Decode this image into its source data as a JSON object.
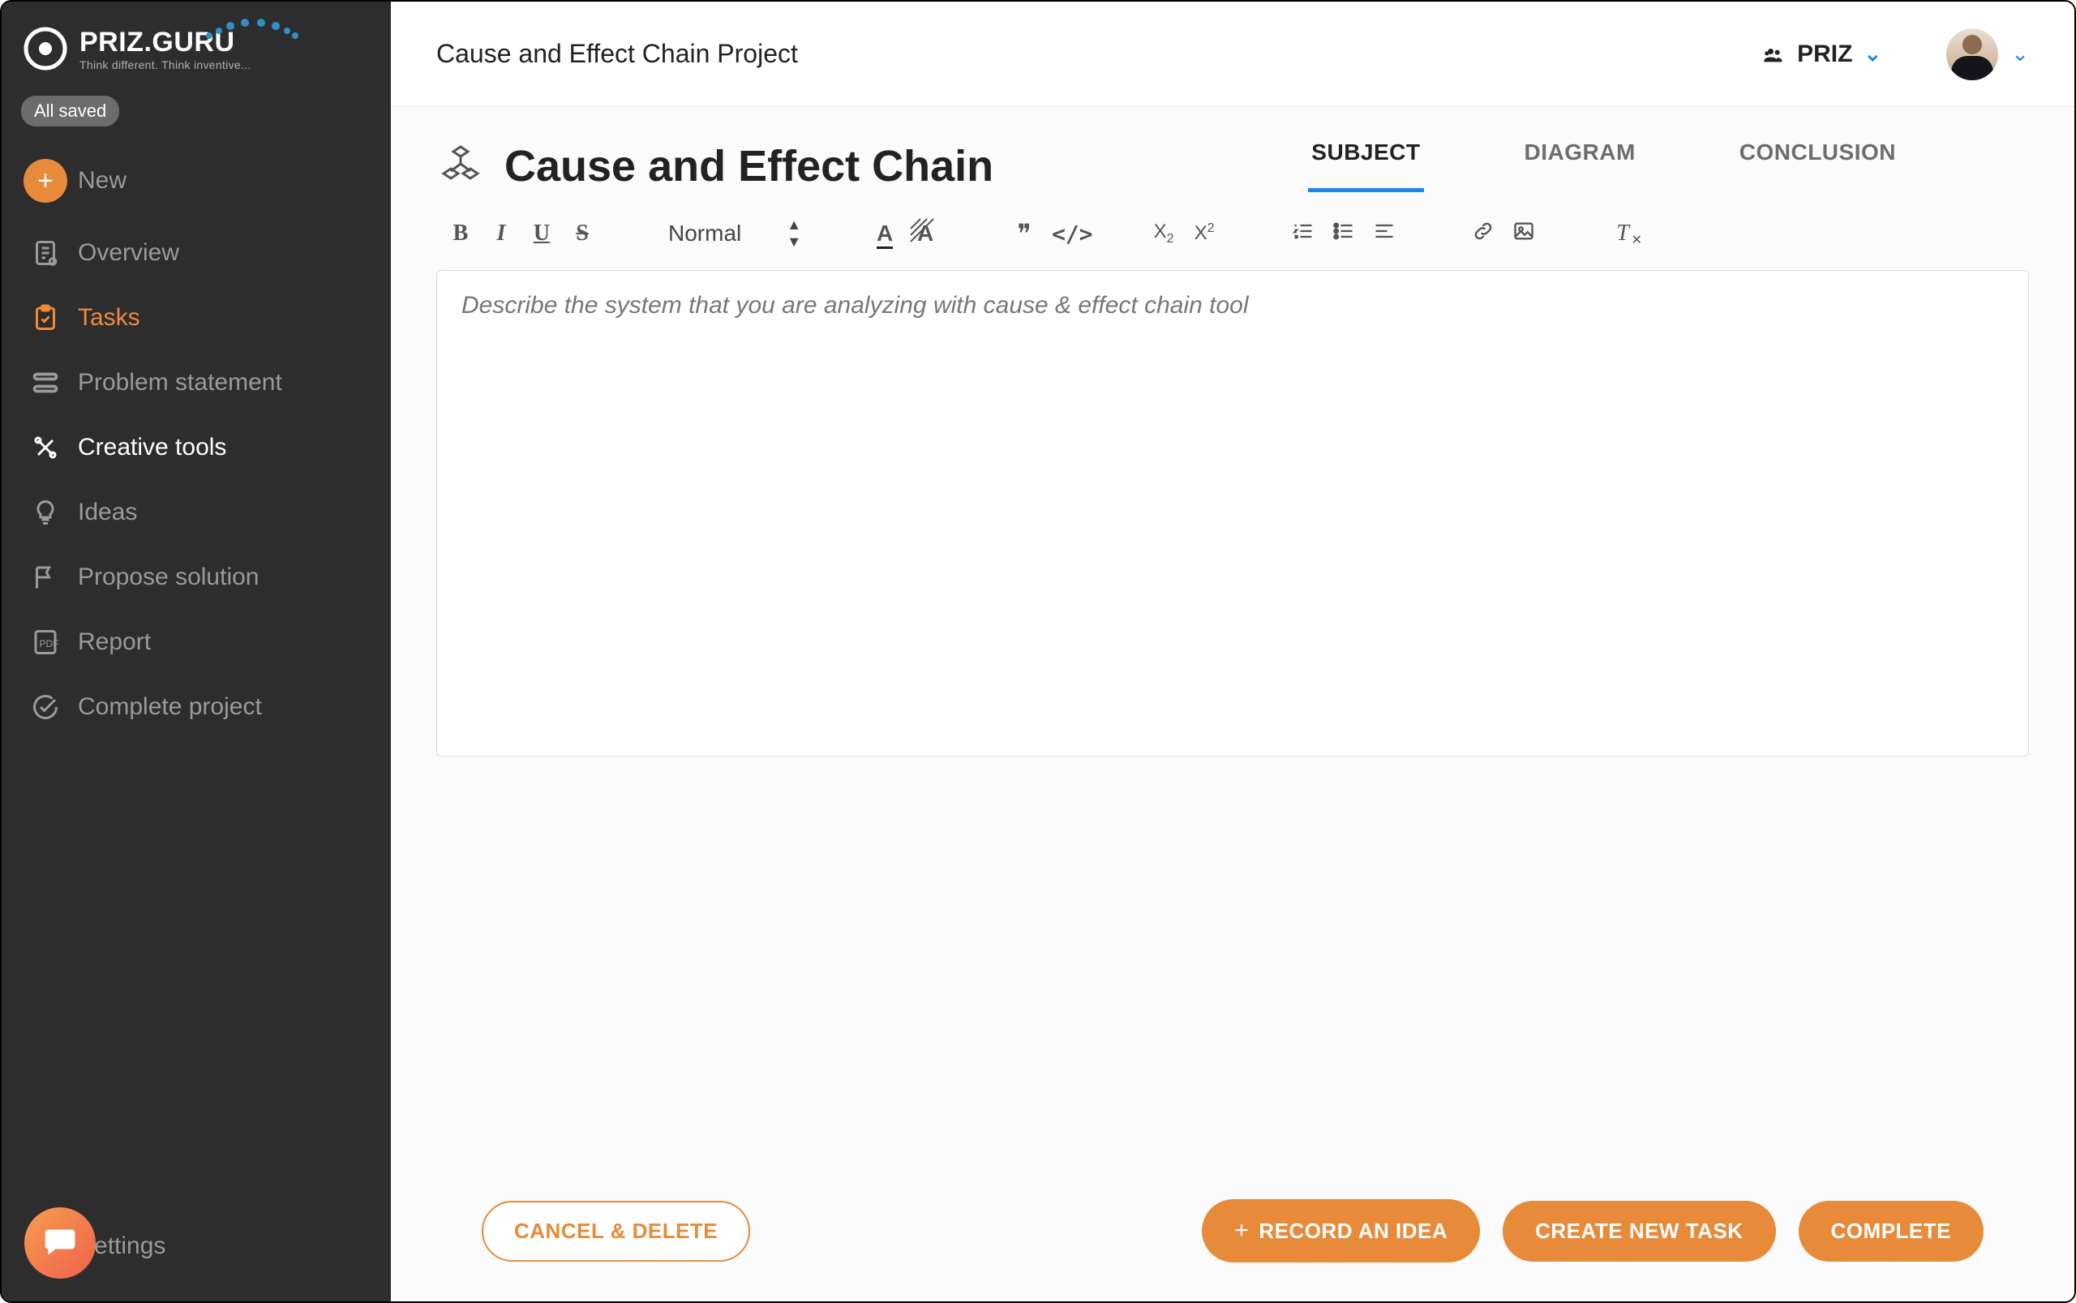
{
  "brand": {
    "name": "PRIZ.GURU",
    "tagline": "Think different. Think inventive..."
  },
  "sidebar": {
    "saved_badge": "All saved",
    "items": [
      {
        "key": "new",
        "label": "New"
      },
      {
        "key": "overview",
        "label": "Overview"
      },
      {
        "key": "tasks",
        "label": "Tasks"
      },
      {
        "key": "problem-statement",
        "label": "Problem statement"
      },
      {
        "key": "creative-tools",
        "label": "Creative tools"
      },
      {
        "key": "ideas",
        "label": "Ideas"
      },
      {
        "key": "propose-solution",
        "label": "Propose solution"
      },
      {
        "key": "report",
        "label": "Report"
      },
      {
        "key": "complete-project",
        "label": "Complete project"
      }
    ],
    "settings_label": "Settings"
  },
  "header": {
    "project_title": "Cause and Effect Chain Project",
    "workspace": "PRIZ"
  },
  "tool": {
    "title": "Cause and Effect Chain",
    "tabs": [
      {
        "key": "subject",
        "label": "SUBJECT",
        "active": true
      },
      {
        "key": "diagram",
        "label": "DIAGRAM",
        "active": false
      },
      {
        "key": "conclusion",
        "label": "CONCLUSION",
        "active": false
      }
    ]
  },
  "editor": {
    "format_label": "Normal",
    "placeholder": "Describe the system that you are analyzing with cause & effect chain tool",
    "value": ""
  },
  "footer": {
    "cancel": "CANCEL & DELETE",
    "record_idea": "RECORD AN IDEA",
    "new_task": "CREATE NEW TASK",
    "complete": "COMPLETE"
  }
}
